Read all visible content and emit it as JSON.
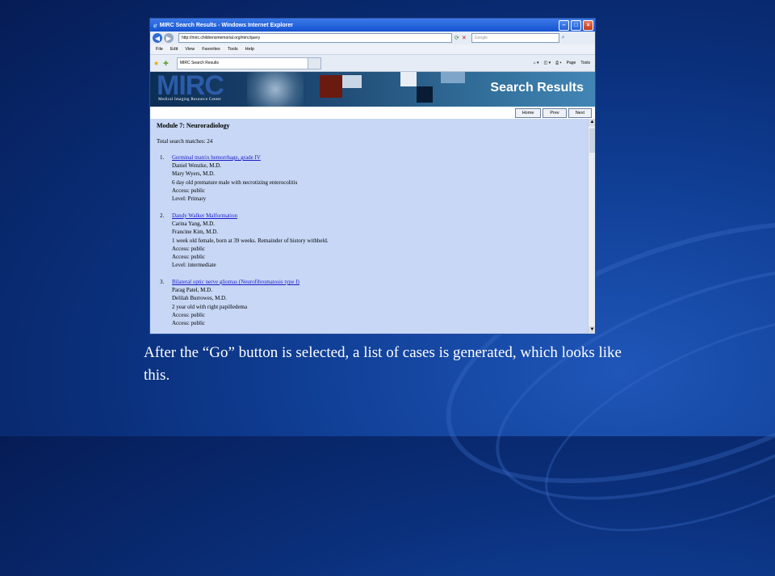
{
  "window": {
    "title": "MIRC Search Results - Windows Internet Explorer"
  },
  "address": {
    "url": "http://mirc.childrensmemorial.org/mirc/query",
    "search_placeholder": "Google"
  },
  "menu": [
    "File",
    "Edit",
    "View",
    "Favorites",
    "Tools",
    "Help"
  ],
  "tab_label": "MIRC Search Results",
  "commands": {
    "page": "Page",
    "tools": "Tools"
  },
  "banner": {
    "logo": "MIRC",
    "subtitle": "Medical Imaging Resource Center",
    "title": "Search Results"
  },
  "nav_buttons": [
    "Home",
    "Prev",
    "Next"
  ],
  "results": {
    "module": "Module 7: Neuroradiology",
    "total": "Total search matches: 24",
    "cases": [
      {
        "num": "1.",
        "title": "Germinal matrix hemorrhage, grade IV",
        "lines": [
          "Daniel Wenzke, M.D.",
          "Mary Wyers, M.D.",
          "6 day old premature male with necrotizing enterocolitis",
          "Access: public",
          "Level: Primary"
        ]
      },
      {
        "num": "2.",
        "title": "Dandy Walker Malformation",
        "lines": [
          "Carina Yang, M.D.",
          "Francine Kim, M.D.",
          "1 week old female, born at 39 weeks. Remainder of history withheld.",
          "Access: public",
          "Access: public",
          "Level: intermediate"
        ]
      },
      {
        "num": "3.",
        "title": "Bilateral optic nerve gliomas (Neurofibromatosis type I)",
        "lines": [
          "Parag Patel, M.D.",
          "Delilah Burrowes, M.D.",
          "2 year old with right papilledema",
          "Access: public",
          "Access: public"
        ]
      }
    ]
  },
  "caption": "After the “Go” button is selected, a list of cases is generated, which looks like this."
}
